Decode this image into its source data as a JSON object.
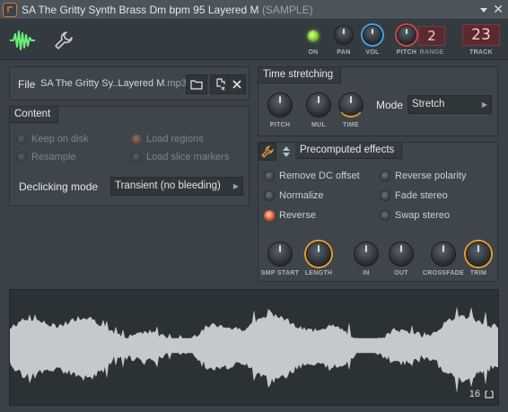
{
  "window": {
    "title": "SA The Gritty Synth Brass Dm bpm 95 Layered M",
    "title_suffix": "(SAMPLE)"
  },
  "toolbar": {
    "on_label": "ON",
    "pan_label": "PAN",
    "vol_label": "VOL",
    "pitch_label": "PITCH",
    "range_label": "RANGE",
    "range_value": "2",
    "track_label": "TRACK",
    "track_value": "23",
    "on_state": true
  },
  "file": {
    "label": "File",
    "name": "SA The Gritty Sy..Layered M",
    "ext": ".mp3"
  },
  "content": {
    "header": "Content",
    "options": [
      {
        "label": "Keep on disk",
        "enabled": false
      },
      {
        "label": "Load regions",
        "enabled": false
      },
      {
        "label": "Resample",
        "enabled": false
      },
      {
        "label": "Load slice markers",
        "enabled": false
      }
    ],
    "declicking_label": "Declicking mode",
    "declicking_value": "Transient (no bleeding)"
  },
  "time_stretching": {
    "header": "Time stretching",
    "knobs": [
      "PITCH",
      "MUL",
      "TIME"
    ],
    "mode_label": "Mode",
    "mode_value": "Stretch"
  },
  "precomputed": {
    "header": "Precomputed effects",
    "options": [
      {
        "label": "Remove DC offset",
        "active": false
      },
      {
        "label": "Reverse polarity",
        "active": false
      },
      {
        "label": "Normalize",
        "active": false
      },
      {
        "label": "Fade stereo",
        "active": false
      },
      {
        "label": "Reverse",
        "active": true
      },
      {
        "label": "Swap stereo",
        "active": false
      }
    ],
    "knobs": [
      "SMP START",
      "LENGTH",
      "IN",
      "OUT",
      "CROSSFADE",
      "TRIM"
    ]
  },
  "waveform": {
    "count": "16"
  },
  "colors": {
    "accent_orange": "#e89c2c",
    "accent_blue": "#3ea6e8",
    "on_led": "#7ccd2a",
    "display_red": "#5a2a2e"
  }
}
